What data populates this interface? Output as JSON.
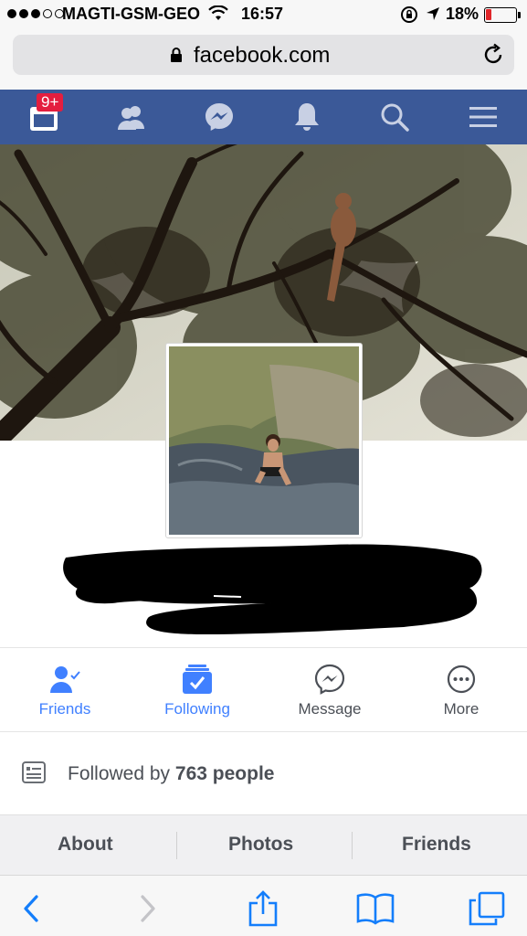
{
  "status_bar": {
    "carrier": "MAGTI-GSM-GEO",
    "time": "16:57",
    "battery": "18%",
    "battery_level": 0.18,
    "icons": [
      "signal-dots",
      "wifi-icon",
      "rotation-lock-icon",
      "location-arrow-icon",
      "battery-icon"
    ]
  },
  "browser": {
    "url": "facebook.com",
    "icons": [
      "padlock-icon",
      "reload-icon"
    ]
  },
  "fb_nav": {
    "notification_badge": "9+",
    "items": [
      "news-feed-icon",
      "friend-requests-icon",
      "messenger-icon",
      "notifications-bell-icon",
      "search-icon",
      "menu-icon"
    ]
  },
  "actions": [
    {
      "label": "Friends",
      "icon": "friends-check-icon",
      "color": "#4080ff"
    },
    {
      "label": "Following",
      "icon": "following-check-icon",
      "color": "#4080ff"
    },
    {
      "label": "Message",
      "icon": "messenger-icon",
      "color": "#4b4f56"
    },
    {
      "label": "More",
      "icon": "more-dots-icon",
      "color": "#4b4f56"
    }
  ],
  "followers": {
    "prefix": "Followed by",
    "count": "763 people"
  },
  "tabs": [
    "About",
    "Photos",
    "Friends"
  ],
  "toolbar": {
    "icons": [
      "back-icon",
      "forward-icon",
      "share-icon",
      "bookmarks-icon",
      "tabs-icon"
    ]
  },
  "colors": {
    "fb_blue": "#3b5998",
    "accent_blue": "#4080ff",
    "badge_red": "#e41e3f"
  }
}
